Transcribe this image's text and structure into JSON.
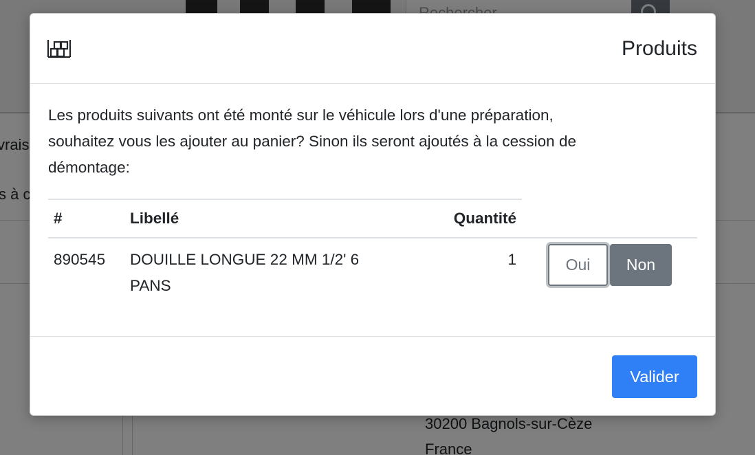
{
  "background": {
    "search_placeholder": "Rechercher",
    "left_text_1": "vrais",
    "left_text_2": "s à c",
    "address_line_1": "30200 Bagnols-sur-Cèze",
    "address_line_2": "France"
  },
  "modal": {
    "title": "Produits",
    "header_icon": "warehouse-icon",
    "intro_line_1": "Les produits suivants ont été monté sur le véhicule lors d'une préparation,",
    "intro_line_2": "souhaitez vous les ajouter au panier? Sinon ils seront ajoutés à la cession de",
    "intro_line_3": "démontage:",
    "table": {
      "headers": {
        "ref": "#",
        "label": "Libellé",
        "quantity": "Quantité"
      },
      "rows": [
        {
          "ref": "890545",
          "label_line_1": "DOUILLE LONGUE 22 MM 1/2' 6",
          "label_line_2": "PANS",
          "quantity": "1",
          "yes_label": "Oui",
          "no_label": "Non"
        }
      ]
    },
    "submit_label": "Valider"
  },
  "colors": {
    "primary": "#2f7ff7",
    "secondary": "#6c757d",
    "backdrop": "rgba(0,0,0,0.5)"
  }
}
